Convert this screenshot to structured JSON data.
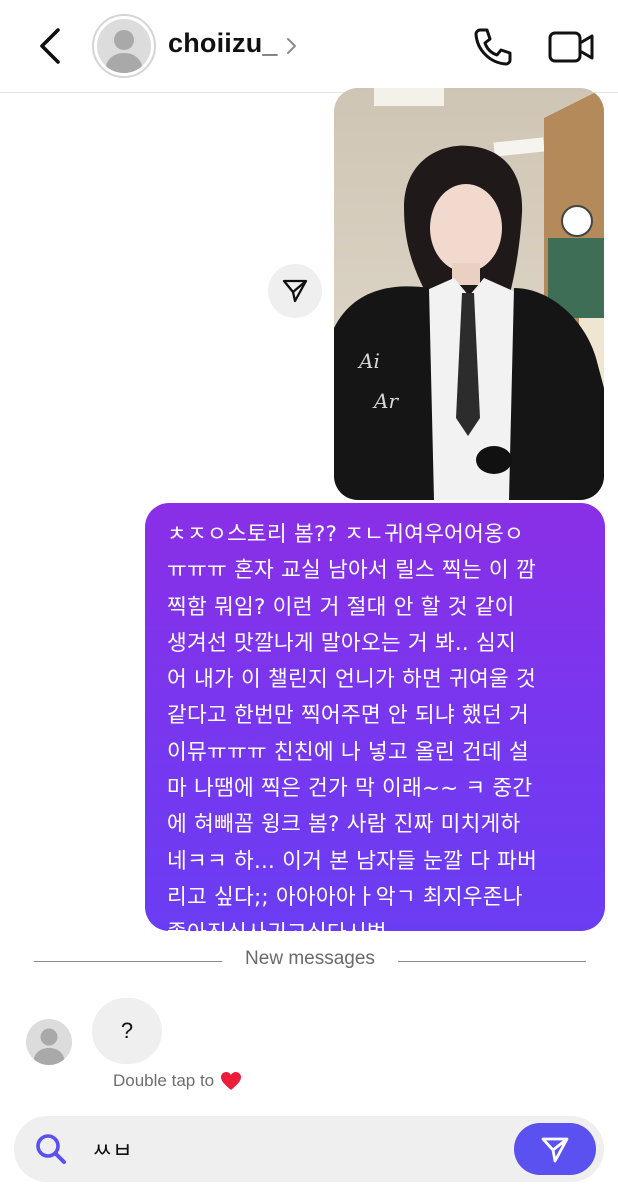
{
  "header": {
    "username": "choiizu_",
    "icons": {
      "back": "chevron-left-icon",
      "profile_chevron": "chevron-right-icon",
      "call": "phone-icon",
      "video": "video-camera-icon"
    }
  },
  "photo_message": {
    "share_icon": "send-arrow-icon"
  },
  "sent_message": {
    "lines": [
      "ㅊㅈㅇ스토리 봄?? ㅈㄴ귀여우어어옹ㅇ",
      "ㅠㅠㅠ 혼자 교실 남아서 릴스 찍는 이 깜",
      "찍함 뭐임? 이런 거 절대 안 할 것 같이",
      "생겨선 맛깔나게 말아오는 거 봐.. 심지",
      "어 내가 이 챌린지 언니가 하면 귀여울 것",
      "같다고 한번만 찍어주면 안 되냐 했던 거",
      "이뮤ㅠㅠㅠ 친친에 나 넣고 올린 건데 설",
      "마 나땜에 찍은 건가 막 이래~~ ㅋ 중간",
      "에 혀빼꼼 윙크 봄? 사람 진짜 미치게하",
      "네ㅋㅋ 하... 이거 본 남자들 눈깔 다 파버",
      "리고 싶다;; 아아아아ㅏ악ㄱ 최지우존나",
      "좋아진심사귀고싶다시벌.."
    ],
    "colors": {
      "top": "#8a2fe6",
      "bottom": "#6a3df3"
    }
  },
  "divider": {
    "label": "New messages"
  },
  "received_message": {
    "text": "?",
    "hint": "Double tap to",
    "hint_icon": "red-heart-icon"
  },
  "composer": {
    "value": "ㅆㅂ",
    "search_icon": "search-icon",
    "send_icon": "send-arrow-icon",
    "accent": "#5b50f0"
  }
}
